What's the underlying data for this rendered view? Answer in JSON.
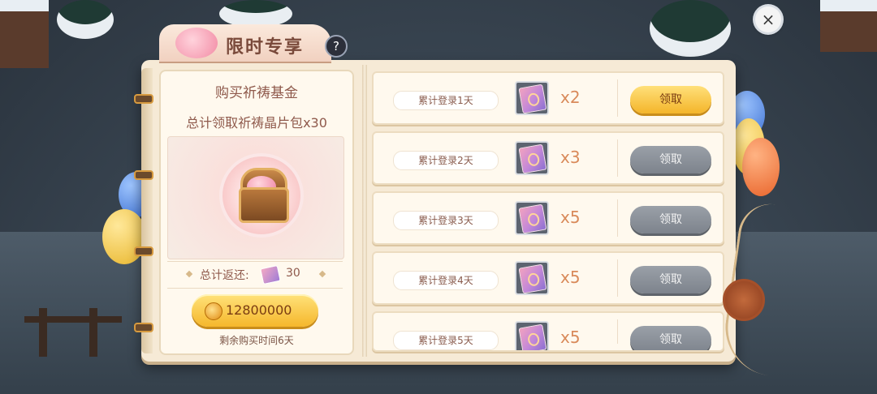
{
  "header": {
    "title": "限时专享",
    "help_symbol": "?",
    "close_symbol": "×"
  },
  "fund_panel": {
    "title": "购买祈祷基金",
    "subtitle": "总计领取祈祷晶片包x30",
    "total_rebate_label": "总计返还:",
    "total_rebate_value": "30",
    "price": "12800000",
    "remaining_time": "剩余购买时间6天"
  },
  "rewards": [
    {
      "day_label": "累计登录1天",
      "quantity": "x2",
      "claim_label": "领取",
      "state": "active"
    },
    {
      "day_label": "累计登录2天",
      "quantity": "x3",
      "claim_label": "领取",
      "state": "disabled"
    },
    {
      "day_label": "累计登录3天",
      "quantity": "x5",
      "claim_label": "领取",
      "state": "disabled"
    },
    {
      "day_label": "累计登录4天",
      "quantity": "x5",
      "claim_label": "领取",
      "state": "disabled"
    },
    {
      "day_label": "累计登录5天",
      "quantity": "x5",
      "claim_label": "领取",
      "state": "disabled"
    }
  ],
  "icons": {
    "reward_item": "prayer-shard-pack-icon",
    "currency": "gold-coin-icon",
    "chest": "treasure-chest-icon"
  },
  "colors": {
    "active_button": "#f5b72c",
    "disabled_button": "#8a9098",
    "text_brown": "#8f5a4c",
    "quantity_orange": "#d98a5a"
  }
}
